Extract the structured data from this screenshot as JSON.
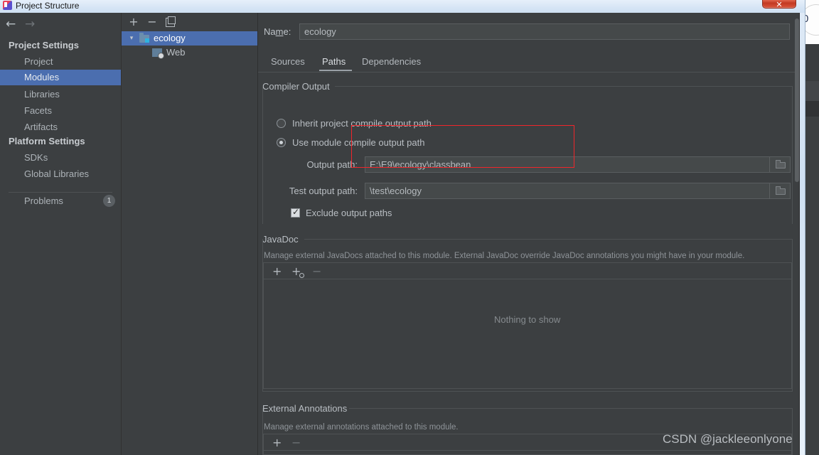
{
  "window": {
    "title": "Project Structure",
    "title_icon": "intellij-idea-icon",
    "close_label": "✕"
  },
  "sidebar": {
    "back_icon": "arrow-left-icon",
    "forward_icon": "arrow-right-icon",
    "groups": [
      {
        "label": "Project Settings"
      },
      {
        "label": "Platform Settings"
      }
    ],
    "items": [
      {
        "label": "Project",
        "selected": false
      },
      {
        "label": "Modules",
        "selected": true
      },
      {
        "label": "Libraries",
        "selected": false
      },
      {
        "label": "Facets",
        "selected": false
      },
      {
        "label": "Artifacts",
        "selected": false
      },
      {
        "label": "SDKs",
        "selected": false
      },
      {
        "label": "Global Libraries",
        "selected": false
      }
    ],
    "problems": {
      "label": "Problems",
      "count": "1"
    }
  },
  "tree": {
    "toolbar": {
      "add": "+",
      "remove": "−",
      "copy_icon": "copy-icon"
    },
    "nodes": [
      {
        "label": "ecology",
        "icon": "module-folder-icon",
        "chevron": "▾",
        "selected": true
      },
      {
        "label": "Web",
        "icon": "web-facet-icon",
        "selected": false
      }
    ]
  },
  "main": {
    "name_label_pre": "Na",
    "name_label_underlined": "m",
    "name_label_post": "e:",
    "name_value": "ecology",
    "tabs": [
      {
        "label": "Sources",
        "active": false
      },
      {
        "label": "Paths",
        "active": true
      },
      {
        "label": "Dependencies",
        "active": false
      }
    ],
    "compiler_output": {
      "title": "Compiler Output",
      "radio_inherit": "Inherit project compile output path",
      "radio_module": "Use module compile output path",
      "radio_selected": "module",
      "output_path_label": "Output path:",
      "output_path_value": "E:\\E9\\ecology\\classbean",
      "test_output_path_label": "Test output path:",
      "test_output_path_value": "\\test\\ecology",
      "exclude_label": "Exclude output paths",
      "exclude_checked": true,
      "browse_icon": "folder-browse-icon"
    },
    "javadoc": {
      "title": "JavaDoc",
      "description": "Manage external JavaDocs attached to this module. External JavaDoc override JavaDoc annotations you might have in your module.",
      "toolbar": {
        "add": "+",
        "add_url": "+",
        "remove": "−"
      },
      "empty_text": "Nothing to show"
    },
    "external_annotations": {
      "title": "External Annotations",
      "description": "Manage external annotations attached to this module.",
      "toolbar": {
        "add": "+",
        "remove": "−"
      }
    }
  },
  "annotation": {
    "highlight_color": "#f0262b"
  },
  "background_window": {
    "digit": "0"
  },
  "watermark": "CSDN @jackleeonlyone"
}
